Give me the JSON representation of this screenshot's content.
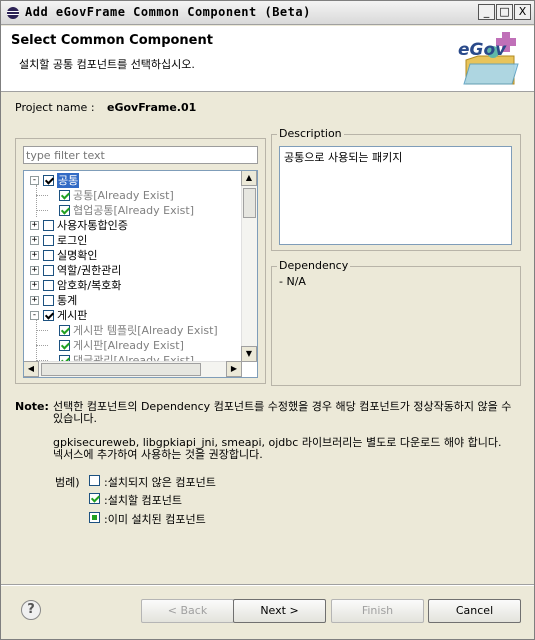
{
  "window": {
    "title": "Add eGovFrame Common Component (Beta)",
    "min_label": "_",
    "max_label": "□",
    "close_label": "X"
  },
  "header": {
    "title": "Select Common Component",
    "subtitle": "설치할 공통 컴포넌트를 선택하십시오.",
    "logo_text": "eGov"
  },
  "project": {
    "label": "Project name :",
    "value": "eGovFrame.01"
  },
  "filter": {
    "placeholder": "type filter text"
  },
  "tree": {
    "items": [
      {
        "label": "공통",
        "level": 0,
        "expander": "-",
        "checked": true,
        "selected": true
      },
      {
        "label": "공통[Already Exist]",
        "level": 1,
        "checked": true,
        "grey": true
      },
      {
        "label": "협업공통[Already Exist]",
        "level": 1,
        "checked": true,
        "grey": true
      },
      {
        "label": "사용자통합인증",
        "level": 0,
        "expander": "+",
        "checked": false
      },
      {
        "label": "로그인",
        "level": 0,
        "expander": "+",
        "checked": false
      },
      {
        "label": "실명확인",
        "level": 0,
        "expander": "+",
        "checked": false
      },
      {
        "label": "역할/권한관리",
        "level": 0,
        "expander": "+",
        "checked": false
      },
      {
        "label": "암호화/복호화",
        "level": 0,
        "expander": "+",
        "checked": false
      },
      {
        "label": "통계",
        "level": 0,
        "expander": "+",
        "checked": false
      },
      {
        "label": "게시판",
        "level": 0,
        "expander": "-",
        "checked": true
      },
      {
        "label": "게시판 템플릿[Already Exist]",
        "level": 1,
        "checked": true,
        "grey": true
      },
      {
        "label": "게시판[Already Exist]",
        "level": 1,
        "checked": true,
        "grey": true
      },
      {
        "label": "댓글관리[Already Exist]",
        "level": 1,
        "checked": true,
        "grey": true
      }
    ]
  },
  "description": {
    "label": "Description",
    "text": "공통으로 사용되는 패키지"
  },
  "dependency": {
    "label": "Dependency",
    "text": "- N/A"
  },
  "note": {
    "label": "Note:",
    "line1": "선택한 컴포넌트의 Dependency 컴포넌트를 수정했을 경우 해당 컴포넌트가 정상작동하지 않을 수 있습니다.",
    "line2": "gpkisecureweb, libgpkiapi_jni, smeapi, ojdbc 라이브러리는 별도로 다운로드 해야 합니다. 넥서스에 추가하여 사용하는 것을 권장합니다."
  },
  "legend": {
    "label": "범례)",
    "items": [
      {
        "text": ":설치되지 않은 컴포넌트"
      },
      {
        "text": ":설치할 컴포넌트"
      },
      {
        "text": ":이미 설치된 컴포넌트"
      }
    ]
  },
  "buttons": {
    "help": "?",
    "back": "< Back",
    "next": "Next >",
    "finish": "Finish",
    "cancel": "Cancel"
  },
  "colors": {
    "selection": "#316ac5",
    "check_green": "#21a121",
    "dialog_bg": "#ece9d8"
  }
}
